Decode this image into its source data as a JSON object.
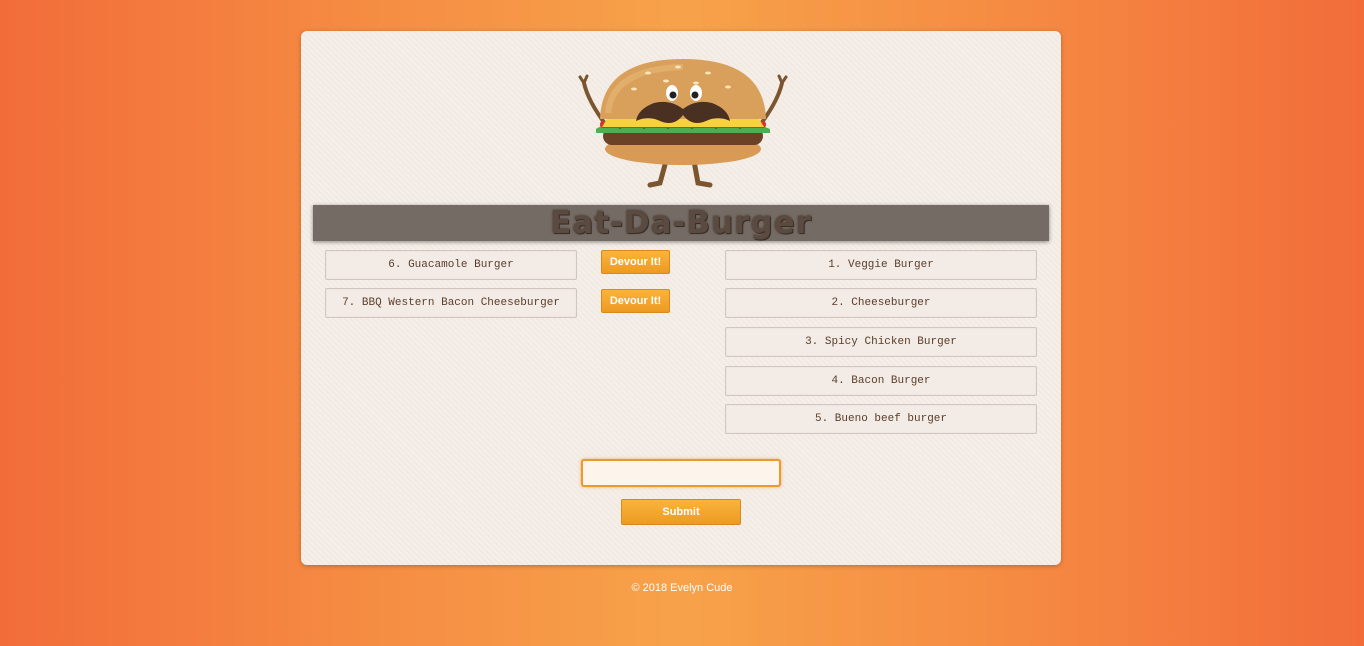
{
  "header": {
    "title": "Eat-Da-Burger"
  },
  "uneaten": [
    {
      "label": "6. Guacamole Burger",
      "button": "Devour It!"
    },
    {
      "label": "7. BBQ Western Bacon Cheeseburger",
      "button": "Devour It!"
    }
  ],
  "devoured": [
    {
      "label": "1. Veggie Burger"
    },
    {
      "label": "2. Cheeseburger"
    },
    {
      "label": "3. Spicy Chicken Burger"
    },
    {
      "label": "4. Bacon Burger"
    },
    {
      "label": "5. Bueno beef burger"
    }
  ],
  "form": {
    "input_value": "",
    "submit_label": "Submit"
  },
  "footer": {
    "text": "© 2018 Evelyn Cude"
  },
  "colors": {
    "background_orange": "#f58a42",
    "banner": "#736b64",
    "button_orange": "#f5a82e",
    "card": "#f6efe8"
  },
  "icons": {
    "logo": "burger-mascot-icon"
  }
}
